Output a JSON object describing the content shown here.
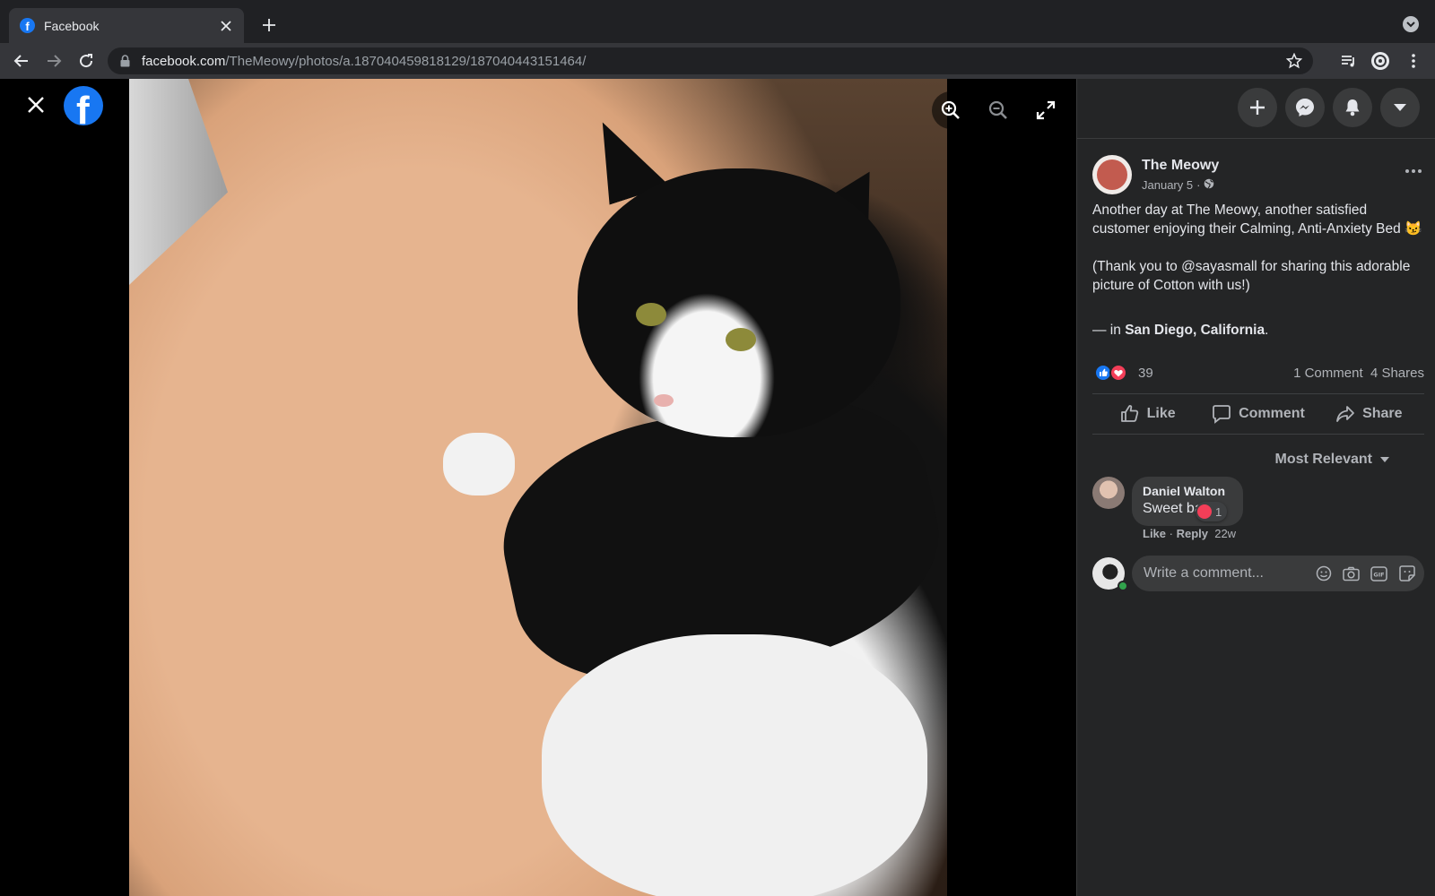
{
  "browser": {
    "tab_title": "Facebook",
    "url_domain": "facebook.com",
    "url_path": "/TheMeowy/photos/a.187040459818129/187040443151464/"
  },
  "viewer": {
    "logo_letter": "f",
    "photo_description_icon": "cat-on-fluffy-bed-photo"
  },
  "post": {
    "page_name": "The Meowy",
    "date": "January 5",
    "date_separator": "·",
    "text_line1": "Another day at The Meowy, another satisfied customer enjoying their Calming, Anti-Anxiety Bed 😼",
    "text_line2": "(Thank you to @sayasmall for sharing this adorable picture of Cotton with us!)",
    "location_prefix": "— in ",
    "location": "San Diego, California",
    "location_suffix": ".",
    "reaction_count": "39",
    "comments_count": "1 Comment",
    "shares_count": "4 Shares",
    "like_label": "Like",
    "comment_label": "Comment",
    "share_label": "Share",
    "sort_label": "Most Relevant"
  },
  "comments": [
    {
      "author": "Daniel Walton",
      "text": "Sweet baby",
      "reaction_count": "1",
      "like": "Like",
      "sep": " · ",
      "reply": "Reply",
      "time": "22w"
    }
  ],
  "composer": {
    "placeholder": "Write a comment..."
  },
  "colors": {
    "facebook_blue": "#1877f2",
    "panel_bg": "#242526",
    "love_red": "#f33e58"
  }
}
